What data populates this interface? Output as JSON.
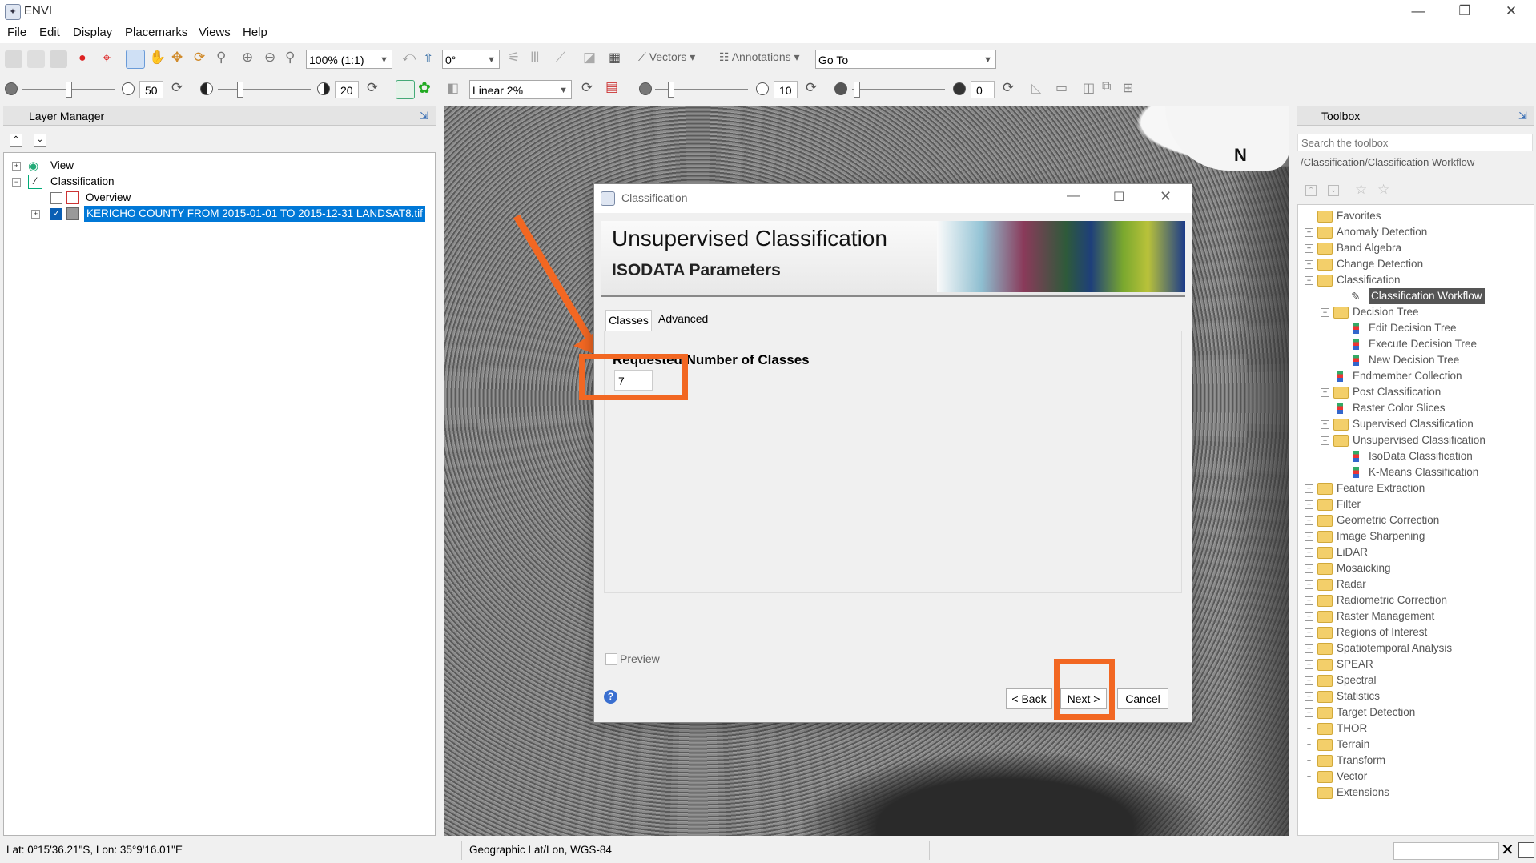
{
  "window": {
    "title": "ENVI",
    "icon": "envi-app-icon"
  },
  "menu": [
    "File",
    "Edit",
    "Display",
    "Placemarks",
    "Views",
    "Help"
  ],
  "toolbar": {
    "zoom": "100% (1:1)",
    "rotation": "0°",
    "vectors": "Vectors",
    "annotations": "Annotations",
    "goto": "Go To",
    "brightness": "50",
    "contrast": "20",
    "stretch": "Linear 2%",
    "sharpen": "10",
    "transparency": "0"
  },
  "layer_manager": {
    "title": "Layer Manager",
    "items": [
      "View",
      "Classification",
      "Overview",
      "KERICHO COUNTY FROM 2015-01-01 TO 2015-12-31 LANDSAT8.tif"
    ]
  },
  "dialog": {
    "window_title": "Classification",
    "heading": "Unsupervised Classification",
    "subheading": "ISODATA Parameters",
    "tabs": [
      "Classes",
      "Advanced"
    ],
    "field_label": "Requested Number of Classes",
    "field_value": "7",
    "preview_label": "Preview",
    "back_label": "< Back",
    "next_label": "Next >",
    "cancel_label": "Cancel"
  },
  "toolbox": {
    "title": "Toolbox",
    "search_placeholder": "Search the toolbox",
    "path": "/Classification/Classification Workflow",
    "items": [
      "Favorites",
      "Anomaly Detection",
      "Band Algebra",
      "Change Detection",
      "Classification",
      "Classification Workflow",
      "Decision Tree",
      "Edit Decision Tree",
      "Execute Decision Tree",
      "New Decision Tree",
      "Endmember Collection",
      "Post Classification",
      "Raster Color Slices",
      "Supervised Classification",
      "Unsupervised Classification",
      "IsoData Classification",
      "K-Means Classification",
      "Feature Extraction",
      "Filter",
      "Geometric Correction",
      "Image Sharpening",
      "LiDAR",
      "Mosaicking",
      "Radar",
      "Radiometric Correction",
      "Raster Management",
      "Regions of Interest",
      "Spatiotemporal Analysis",
      "SPEAR",
      "Spectral",
      "Statistics",
      "Target Detection",
      "THOR",
      "Terrain",
      "Transform",
      "Vector",
      "Extensions"
    ]
  },
  "status": {
    "coords": "Lat: 0°15'36.21\"S, Lon: 35°9'16.01\"E",
    "projection": "Geographic Lat/Lon, WGS-84"
  },
  "colors": {
    "accent": "#f26722",
    "selection": "#0078d7"
  }
}
